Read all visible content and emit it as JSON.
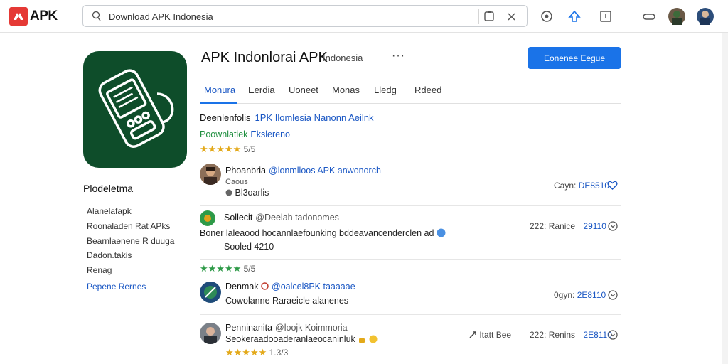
{
  "brand": {
    "logo_text": "APK",
    "accent": "#e53935",
    "primary": "#1a73e8"
  },
  "search": {
    "value": "Download APK Indonesia",
    "icons": [
      "search-icon",
      "camera-icon",
      "close-icon"
    ]
  },
  "toolbar": {
    "icons": [
      "timer-icon",
      "puzzle-icon",
      "bookmark-icon",
      "link-icon",
      "avatar",
      "profile-avatar"
    ]
  },
  "app": {
    "title": "APK Indonlorai APK",
    "subtitle": "Indonesia",
    "more": "···",
    "action_label": "Eonenee Eegue"
  },
  "tabs": [
    "Monura",
    "Eerdia",
    "Uoneet",
    "Monas",
    "Lledg",
    "Rdeed"
  ],
  "description": {
    "label": "Deenlenfolis",
    "link": "1PK Ilomlesia Nanonn Aeilnk",
    "meta_label": "Poownlatiek",
    "meta_link": "Ekslereno",
    "stars": "★★★★★",
    "rating": "5/5"
  },
  "sidebar": {
    "title": "Plodeletma",
    "items": [
      "Alanelafapk",
      "Roonaladen Rat APks",
      "Bearnlaenene R duuga",
      "Dadon.takis",
      "Renag"
    ],
    "link": "Pepene Rernes"
  },
  "reviews": [
    {
      "name": "Phoanbria",
      "handle": "@lonmlloos APK anwonorch",
      "line1": "Caous",
      "line2": "Bl3oarlis",
      "right_label": "Cayn:",
      "count": "DE8510"
    },
    {
      "name": "Sollecit",
      "handle": "@Deelah tadonomes",
      "line1": "Boner laleaood hocannlaefounking bddeavancenderclen ad",
      "line2": "Sooled 4210",
      "right_label": "222: Ranice",
      "count": "29110",
      "stars": "★★★★★",
      "rating": "5/5"
    },
    {
      "name": "Denmak",
      "handle": "@oalcel8PK taaaaae",
      "line1": "Cowolanne Raraeicle alanenes",
      "right_label": "0gyn:",
      "count": "2E8110"
    },
    {
      "name": "Penninanita",
      "handle": "@loojk Koimmoria",
      "line1": "Seokeraadooaderanlaeocaninluk",
      "extra": "Itatt Bee",
      "right_label": "222: Renins",
      "count": "2E8110",
      "stars": "★★★★★",
      "rating": "1.3/3"
    }
  ]
}
